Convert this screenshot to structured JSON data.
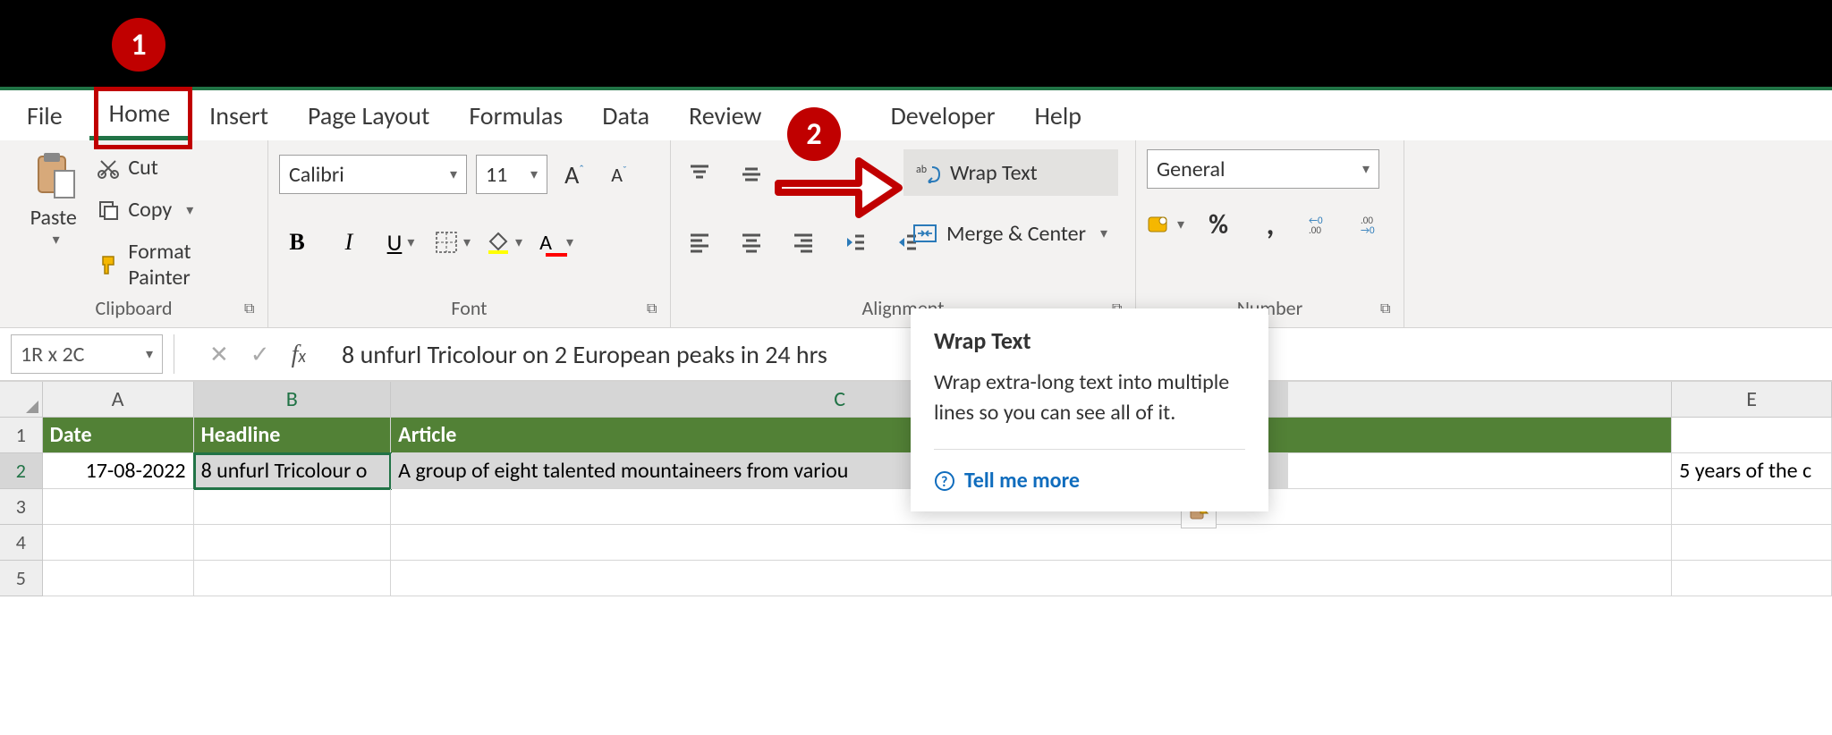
{
  "annotations": {
    "badge1": "1",
    "badge2": "2"
  },
  "tabs": {
    "file": "File",
    "home": "Home",
    "insert": "Insert",
    "page_layout": "Page Layout",
    "formulas": "Formulas",
    "data": "Data",
    "review": "Review",
    "developer": "Developer",
    "help": "Help"
  },
  "clipboard": {
    "paste": "Paste",
    "cut": "Cut",
    "copy": "Copy",
    "format_painter": "Format Painter",
    "group": "Clipboard"
  },
  "font": {
    "name": "Calibri",
    "size": "11",
    "group": "Font"
  },
  "alignment": {
    "wrap": "Wrap Text",
    "merge": "Merge & Center",
    "group": "Alignment"
  },
  "number": {
    "format": "General",
    "group": "Number"
  },
  "tooltip": {
    "title": "Wrap Text",
    "body": "Wrap extra-long text into multiple lines so you can see all of it.",
    "tell_more": "Tell me more"
  },
  "formula_bar": {
    "namebox": "1R x 2C",
    "content": "8 unfurl Tricolour on 2 European peaks in 24 hrs"
  },
  "columns": [
    "A",
    "B",
    "C",
    "E"
  ],
  "col_widths": {
    "A": 170,
    "B": 222,
    "C": 1010,
    "gap": 432,
    "E": 180
  },
  "headers": {
    "A": "Date",
    "B": "Headline",
    "C": "Article"
  },
  "row2": {
    "A": "17-08-2022",
    "B": "8 unfurl Tricolour o",
    "C": "A group of eight talented mountaineers from variou",
    "E": "5 years of the c"
  },
  "row_labels": [
    "1",
    "2",
    "3",
    "4",
    "5"
  ]
}
